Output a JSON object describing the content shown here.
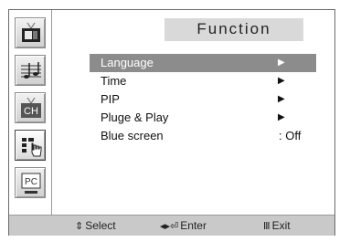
{
  "title": "Function",
  "sidebar": {
    "items": [
      {
        "name": "picture-icon"
      },
      {
        "name": "sound-icon"
      },
      {
        "name": "channel-icon",
        "label": "CH"
      },
      {
        "name": "function-icon"
      },
      {
        "name": "pc-icon",
        "label": "PC"
      }
    ],
    "active_index": 3
  },
  "menu": {
    "items": [
      {
        "label": "Language",
        "value": "▶",
        "selected": true
      },
      {
        "label": "Time",
        "value": "▶"
      },
      {
        "label": "PIP",
        "value": "▶"
      },
      {
        "label": "Pluge & Play",
        "value": "▶"
      },
      {
        "label": "Blue screen",
        "value": ": Off"
      }
    ]
  },
  "footer": {
    "select_icon": "⇕",
    "select_label": "Select",
    "enter_icon": "◂▸⏎",
    "enter_label": "Enter",
    "exit_icon": "Ⅲ",
    "exit_label": "Exit"
  }
}
